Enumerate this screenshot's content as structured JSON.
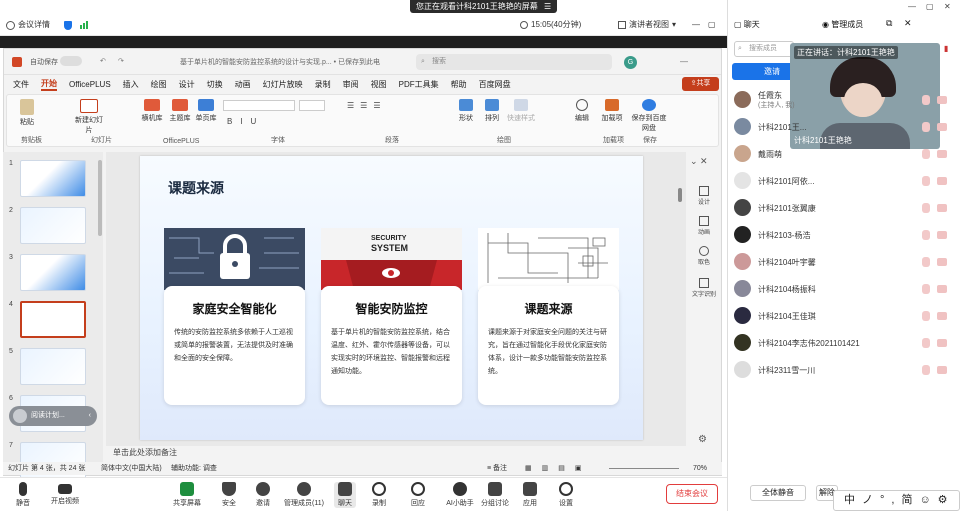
{
  "meeting": {
    "share_banner": "您正在观看计科2101王艳艳的屏幕",
    "info_label": "会议详情",
    "time": "15:05(40分钟)",
    "view_mode": "演讲者视图"
  },
  "ppt": {
    "filename": "基于单片机的智能安防监控系统的设计与实现.p... • 已保存到此电脑",
    "search_placeholder": "搜索",
    "avatar_letter": "G",
    "share_button": "共享",
    "autosave_label": "自动保存",
    "menu": [
      "文件",
      "开始",
      "OfficePLUS",
      "插入",
      "绘图",
      "设计",
      "切换",
      "动画",
      "幻灯片放映",
      "录制",
      "审阅",
      "视图",
      "PDF工具集",
      "帮助",
      "百度网盘"
    ],
    "active_menu": "开始",
    "ribbon": {
      "groups": [
        "剪贴板",
        "幻灯片",
        "OfficePLUS",
        "字体",
        "段落",
        "绘图",
        "加载项",
        "保存"
      ],
      "buttons": [
        "粘贴",
        "新建幻灯片",
        "横机库",
        "主题库",
        "单页库",
        "形状",
        "排列",
        "快速样式",
        "编辑",
        "加载项",
        "保存到百度网盘"
      ]
    },
    "slide_numbers": [
      "1",
      "2",
      "3",
      "4",
      "5",
      "6",
      "7"
    ],
    "slide": {
      "title": "课题来源",
      "cards": [
        {
          "title": "家庭安全智能化",
          "body": "传统的安防监控系统多依赖于人工巡视或简单的报警装置，无法提供及时准确和全面的安全保障。"
        },
        {
          "title": "智能安防监控",
          "body": "基于单片机的智能安防监控系统，结合温度、红外、霍尔传感器等设备，可以实现实时的环境监控、智能报警和远程通知功能。",
          "img_text1": "SECURITY",
          "img_text2": "SYSTEM"
        },
        {
          "title": "课题来源",
          "body": "课题来源于对家庭安全问题的关注与研究，旨在通过智能化手段优化家庭安防体系，设计一款多功能智能安防监控系统。"
        }
      ]
    },
    "right_tools": [
      "设计",
      "动画",
      "取色",
      "文字识别"
    ],
    "notes_placeholder": "单击此处添加备注",
    "status": {
      "slide_info": "幻灯片 第 4 张，共 24 张",
      "language": "简体中文(中国大陆)",
      "accessibility": "辅助功能: 调查",
      "notes_btn": "备注",
      "zoom": "70%"
    },
    "floating_label": "阅读计划..."
  },
  "bottombar": [
    {
      "label": "静音",
      "name": "mute"
    },
    {
      "label": "开启视频",
      "name": "video"
    },
    {
      "label": "共享屏幕",
      "name": "share-screen"
    },
    {
      "label": "安全",
      "name": "security"
    },
    {
      "label": "邀请",
      "name": "invite"
    },
    {
      "label": "管理成员(11)",
      "name": "manage-members"
    },
    {
      "label": "聊天",
      "name": "chat"
    },
    {
      "label": "录制",
      "name": "record"
    },
    {
      "label": "回应",
      "name": "react"
    },
    {
      "label": "AI小助手",
      "name": "ai-assistant"
    },
    {
      "label": "分组讨论",
      "name": "breakout"
    },
    {
      "label": "应用",
      "name": "apps"
    },
    {
      "label": "设置",
      "name": "settings"
    }
  ],
  "end_meeting": "结束会议",
  "panel": {
    "tab_chat": "聊天",
    "tab_members": "管理成员",
    "search_placeholder": "搜索成员",
    "invite_btn": "邀请",
    "speaking_prefix": "正在讲话：计科2101王艳艳",
    "video_label": "计科2101王艳艳",
    "members": [
      {
        "name": "任霞东",
        "sub": "(主持人, 我)"
      },
      {
        "name": "计科2101王..."
      },
      {
        "name": "戴雨萌"
      },
      {
        "name": "计科2101阿依..."
      },
      {
        "name": "计科2101张翼康"
      },
      {
        "name": "计科2103-杨浩"
      },
      {
        "name": "计科2104叶宇馨"
      },
      {
        "name": "计科2104杨振科"
      },
      {
        "name": "计科2104王佳琪"
      },
      {
        "name": "计科2104李志伟2021101421"
      },
      {
        "name": "计科2311雪一川"
      }
    ],
    "mute_all": "全体静音",
    "unmute_all": "解除"
  },
  "ime": "中ノ°,简☺⚙"
}
